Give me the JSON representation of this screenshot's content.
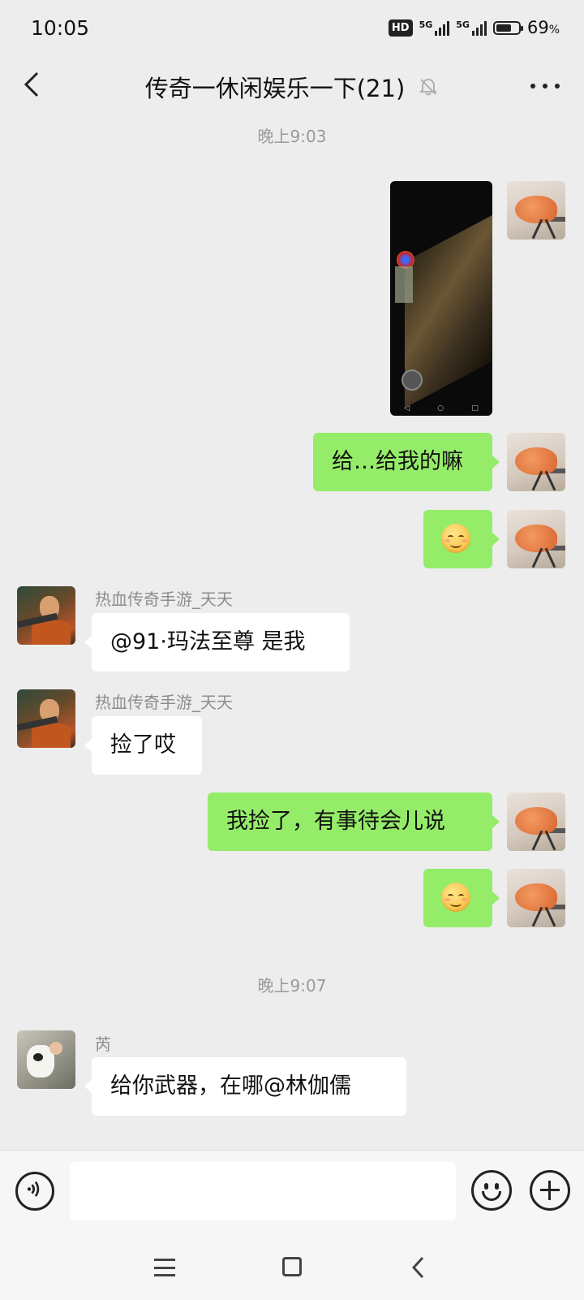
{
  "status_bar": {
    "time": "10:05",
    "hd_badge": "HD",
    "net1": "5G",
    "net2": "5G",
    "battery": "69",
    "battery_unit": "%",
    "battery_level": 0.69
  },
  "header": {
    "title": "传奇一休闲娱乐一下(21)"
  },
  "messages": {
    "ts1": "晚上9:03",
    "m2_text": "给…给我的嘛",
    "s4_name": "热血传奇手游_天天",
    "m4_text": "@91·玛法至尊  是我",
    "s5_name": "热血传奇手游_天天",
    "m5_text": "捡了哎",
    "m6_text": "我捡了，有事待会儿说",
    "ts2": "晚上9:07",
    "s8_name": "芮",
    "m8_text": "给你武器，在哪@林伽儒"
  },
  "icons": {
    "back": "chevron-left-icon",
    "mute": "bell-off-icon",
    "more": "more-dots-icon",
    "voice": "voice-icon",
    "emoji": "emoji-icon",
    "plus": "plus-icon"
  },
  "colors": {
    "background": "#ededed",
    "bubble_self": "#95ec69",
    "bubble_other": "#ffffff",
    "timestamp": "#9a9a9a"
  }
}
